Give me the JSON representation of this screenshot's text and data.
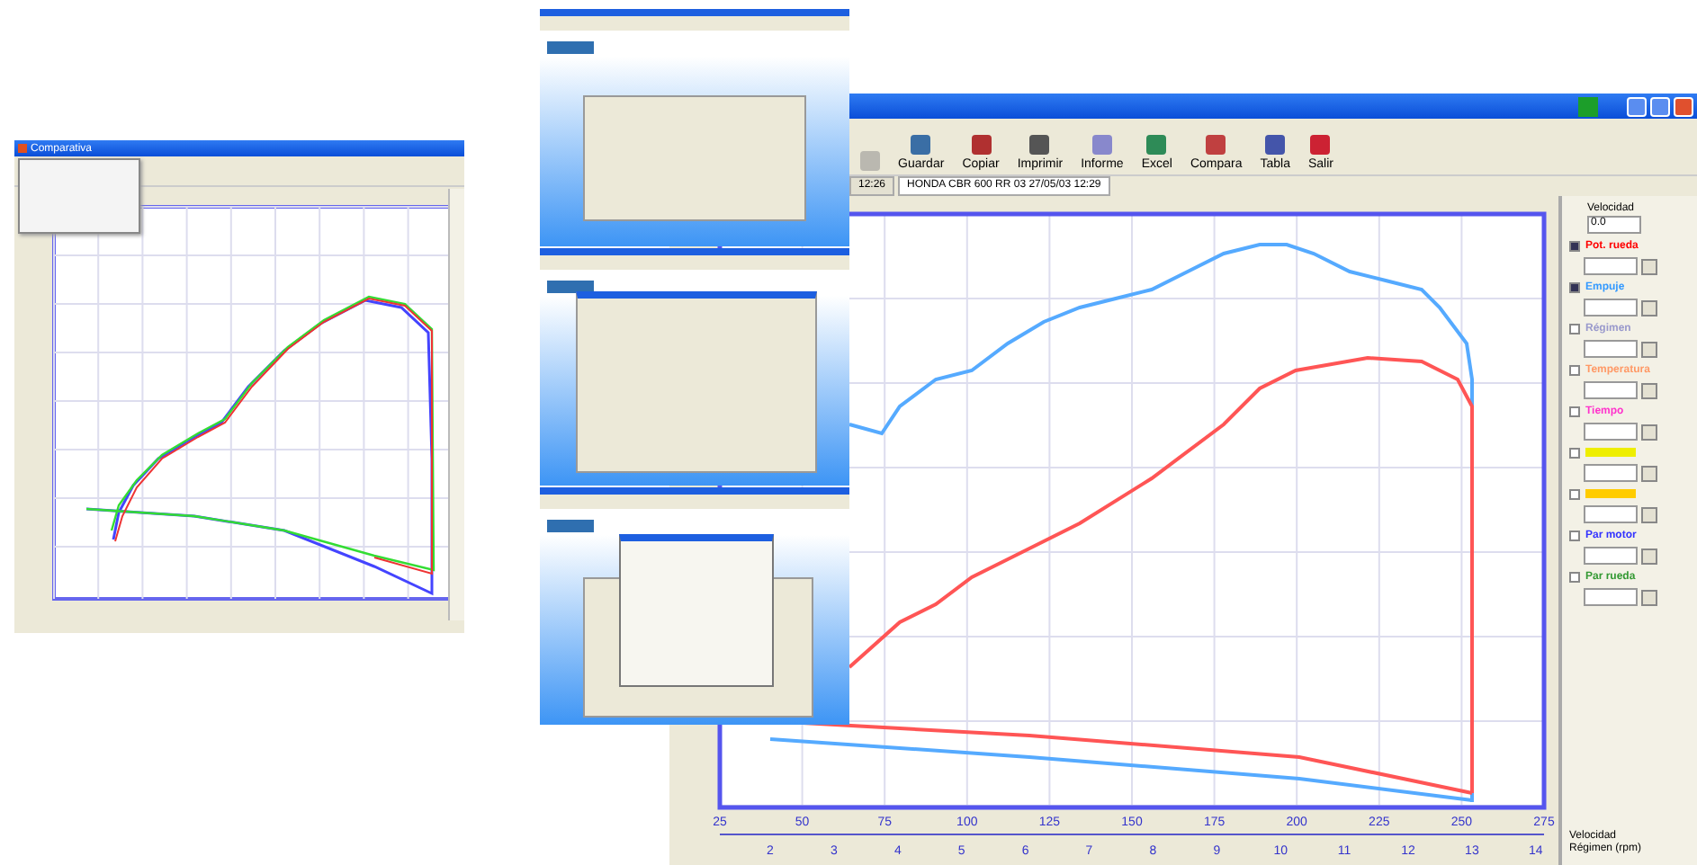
{
  "compare_window": {
    "title": "Comparativa"
  },
  "main_window": {
    "toolbar": [
      {
        "label": "Guardar"
      },
      {
        "label": "Copiar"
      },
      {
        "label": "Imprimir"
      },
      {
        "label": "Informe"
      },
      {
        "label": "Excel"
      },
      {
        "label": "Compara"
      },
      {
        "label": "Tabla"
      },
      {
        "label": "Salir"
      }
    ],
    "tabs": [
      {
        "label": "12:26",
        "selected": false
      },
      {
        "label": "HONDA CBR 600 RR 03 27/05/03 12:29",
        "selected": true
      }
    ],
    "speed_ticks": [
      "25",
      "50",
      "75",
      "100",
      "125",
      "150",
      "175",
      "200",
      "225",
      "250",
      "275"
    ],
    "gear_ticks": [
      "2",
      "3",
      "4",
      "5",
      "6",
      "7",
      "8",
      "9",
      "10",
      "11",
      "12",
      "13",
      "14"
    ],
    "side_panel": {
      "title": "Velocidad",
      "value": "0.0",
      "channels": [
        {
          "label": "Pot. rueda",
          "checked": true,
          "color": "#ff0000"
        },
        {
          "label": "Empuje",
          "checked": true,
          "color": "#3399ff"
        },
        {
          "label": "Régimen",
          "checked": false,
          "color": "#9999cc"
        },
        {
          "label": "Temperatura",
          "checked": false,
          "color": "#ff9966"
        },
        {
          "label": "Tiempo",
          "checked": false,
          "color": "#ff33cc"
        },
        {
          "checked": false,
          "color": "#eeee00"
        },
        {
          "checked": false,
          "color": "#ffcc00"
        },
        {
          "label": "Par motor",
          "checked": false,
          "color": "#3333ff"
        },
        {
          "label": "Par rueda",
          "checked": false,
          "color": "#339933"
        }
      ]
    },
    "footer": [
      "Velocidad",
      "Régimen (rpm)"
    ]
  }
}
